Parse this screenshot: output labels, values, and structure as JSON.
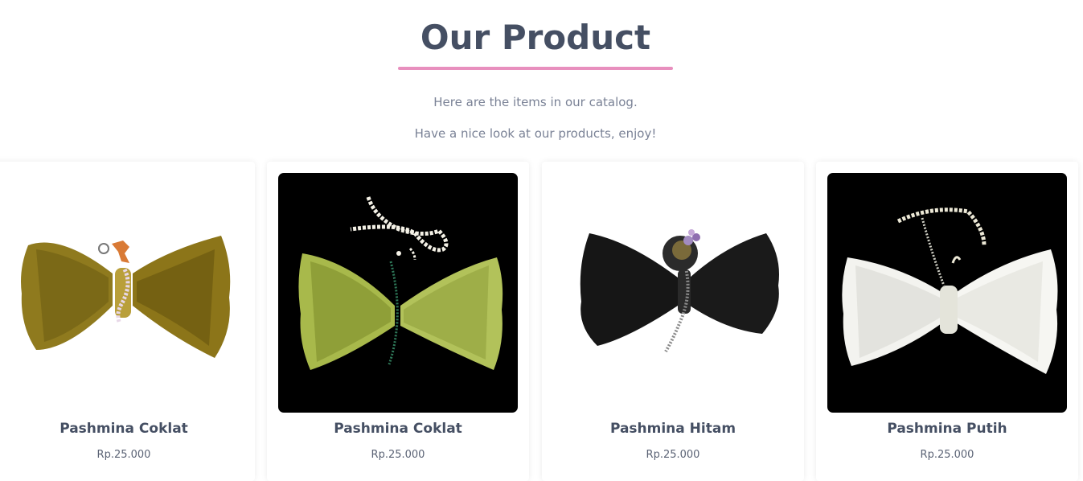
{
  "section": {
    "title": "Our Product",
    "subtitle_1": "Here are the items in our catalog.",
    "subtitle_2": "Have a nice look at our products, enjoy!",
    "accent_color": "#e88fbe"
  },
  "products": [
    {
      "name": "Pashmina Coklat",
      "price": "Rp.25.000",
      "image": "olive-bow-icon",
      "background": "white"
    },
    {
      "name": "Pashmina Coklat",
      "price": "Rp.25.000",
      "image": "green-bow-icon",
      "background": "black"
    },
    {
      "name": "Pashmina Hitam",
      "price": "Rp.25.000",
      "image": "black-bow-icon",
      "background": "white"
    },
    {
      "name": "Pashmina Putih",
      "price": "Rp.25.000",
      "image": "white-bow-icon",
      "background": "black"
    }
  ]
}
